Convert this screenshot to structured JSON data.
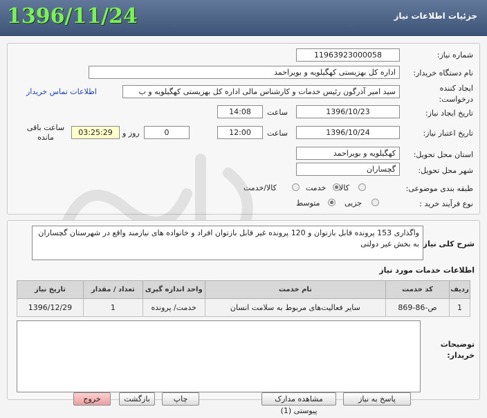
{
  "header": {
    "title": "جزئیات اطلاعات نیاز",
    "date": "1396/11/24"
  },
  "form": {
    "need_number_label": "شماره نیاز:",
    "need_number": "11963923000058",
    "buyer_org_label": "نام دستگاه خریدار:",
    "buyer_org": "اداره کل بهزیستی کهگیلویه و بویراحمد",
    "creator_label": "ایجاد کننده درخواست:",
    "creator": "سید امیر آذرگون رئیس خدمات و کارشناس مالی اداره کل بهزیستی کهگیلویه و ب",
    "contact_link": "اطلاعات تماس خریدار",
    "need_date_label": "تاریخ ایجاد نیاز:",
    "need_date": "1396/10/23",
    "time_word": "ساعت",
    "need_time": "14:08",
    "validity_label": "تاریخ اعتبار نیاز:",
    "validity_date": "1396/10/24",
    "validity_time": "12:00",
    "days_value": "0",
    "days_word": "روز و",
    "remaining_time": "03:25:29",
    "remaining_label": "ساعت باقی مانده",
    "province_label": "استان محل تحویل:",
    "province": "کهگیلویه و بویراحمد",
    "city_label": "شهر محل تحویل:",
    "city": "گچساران",
    "category_label": "طبقه بندی موضوعی:",
    "category_options": [
      "کالا",
      "خدمت",
      "کالا/خدمت"
    ],
    "process_label": "نوع فرآیند خرید :",
    "process_options": [
      "جزیی",
      "متوسط"
    ]
  },
  "description": {
    "label": "شرح کلی نیاز:",
    "text": "واگذاری 153 پرونده قابل بازتوان و 120 پرونده غیر قابل بازتوان افراد و خانواده های نیازمند واقع در شهرستان گچساران به بخش غیر دولتی"
  },
  "services": {
    "title": "اطلاعات خدمات مورد نیاز",
    "columns": [
      "ردیف",
      "کد خدمت",
      "نام خدمت",
      "واحد اندازه گیری",
      "تعداد / مقدار",
      "تاریخ نیاز"
    ],
    "rows": [
      [
        "1",
        "ص-86-869",
        "سایر فعالیت‌های مربوط به سلامت انسان",
        "خدمت/ پرونده",
        "1",
        "1396/12/29"
      ]
    ]
  },
  "buyer_notes": {
    "label": "توضیحات خریدار:",
    "text": ""
  },
  "buttons": {
    "reply": "پاسخ به نیاز",
    "view_docs": "مشاهده مدارک پیوستی (1)",
    "print": "چاپ",
    "back": "بازگشت",
    "exit": "خروج"
  },
  "colors": {
    "header_bg": "#4a6088",
    "date_green": "#7cf05a",
    "link_blue": "#1a3fb0",
    "clock_bg": "#ffffcc"
  }
}
